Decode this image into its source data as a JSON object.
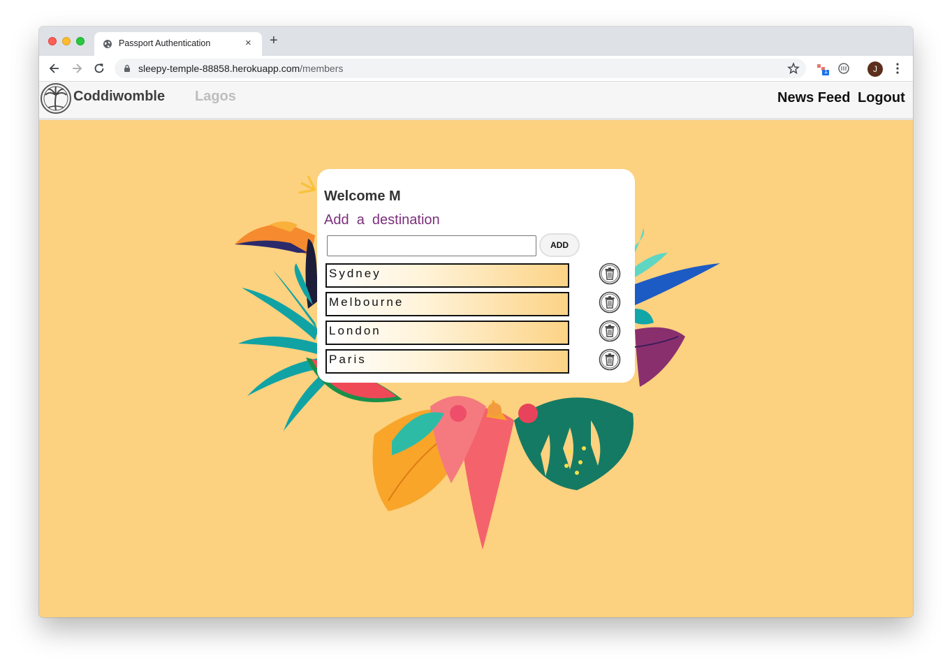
{
  "browser": {
    "tab_title": "Passport Authentication",
    "tab_close_glyph": "×",
    "new_tab_glyph": "+",
    "url_host": "sleepy-temple-88858.herokuapp.com",
    "url_path": "/members",
    "extension_badge": "1",
    "profile_initial": "J"
  },
  "site": {
    "brand": "Coddiwomble",
    "city": "Lagos",
    "nav": {
      "news_feed": "News Feed",
      "logout": "Logout"
    }
  },
  "card": {
    "welcome": "Welcome M",
    "add_title": "Add  a  destination",
    "input_value": "",
    "add_button": "ADD",
    "destinations": [
      "Sydney",
      "Melbourne",
      "London",
      "Paris"
    ]
  },
  "colors": {
    "page_background": "#fcd17f",
    "accent_purple": "#7b2f7b",
    "nav_background": "#f6f6f7"
  },
  "icons": {
    "logo": "palm-tree-logo-icon",
    "delete": "trash-icon"
  }
}
